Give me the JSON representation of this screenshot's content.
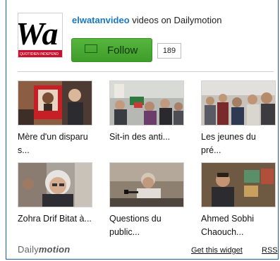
{
  "header": {
    "logo_text": "Wa",
    "logo_band_text": "QUOTIDIEN INDEPEND",
    "channel_name": "elwatanvideo",
    "title_rest": " videos on Dailymotion",
    "follow_label": "Follow",
    "follower_count": "189"
  },
  "videos": [
    {
      "caption": "Mère d'un disparu s...",
      "thumb_icon": "protest-portrait-thumbnail"
    },
    {
      "caption": "Sit-in des anti...",
      "thumb_icon": "crowd-sit-in-thumbnail"
    },
    {
      "caption": "Les jeunes du pré...",
      "thumb_icon": "young-people-crowd-thumbnail"
    },
    {
      "caption": "Zohra Drif Bitat à...",
      "thumb_icon": "elderly-woman-thumbnail"
    },
    {
      "caption": "Questions du public...",
      "thumb_icon": "speaker-microphone-thumbnail"
    },
    {
      "caption": "Ahmed Sobhi Chaouch...",
      "thumb_icon": "man-gallery-thumbnail"
    }
  ],
  "footer": {
    "brand_prefix": "Daily",
    "brand_suffix": "motion",
    "widget_link": "Get this widget",
    "rss_link": "RSS"
  },
  "colors": {
    "accent_blue": "#1a78c2",
    "follow_green": "#4aaa33",
    "border_blue": "#1c5c9e"
  }
}
